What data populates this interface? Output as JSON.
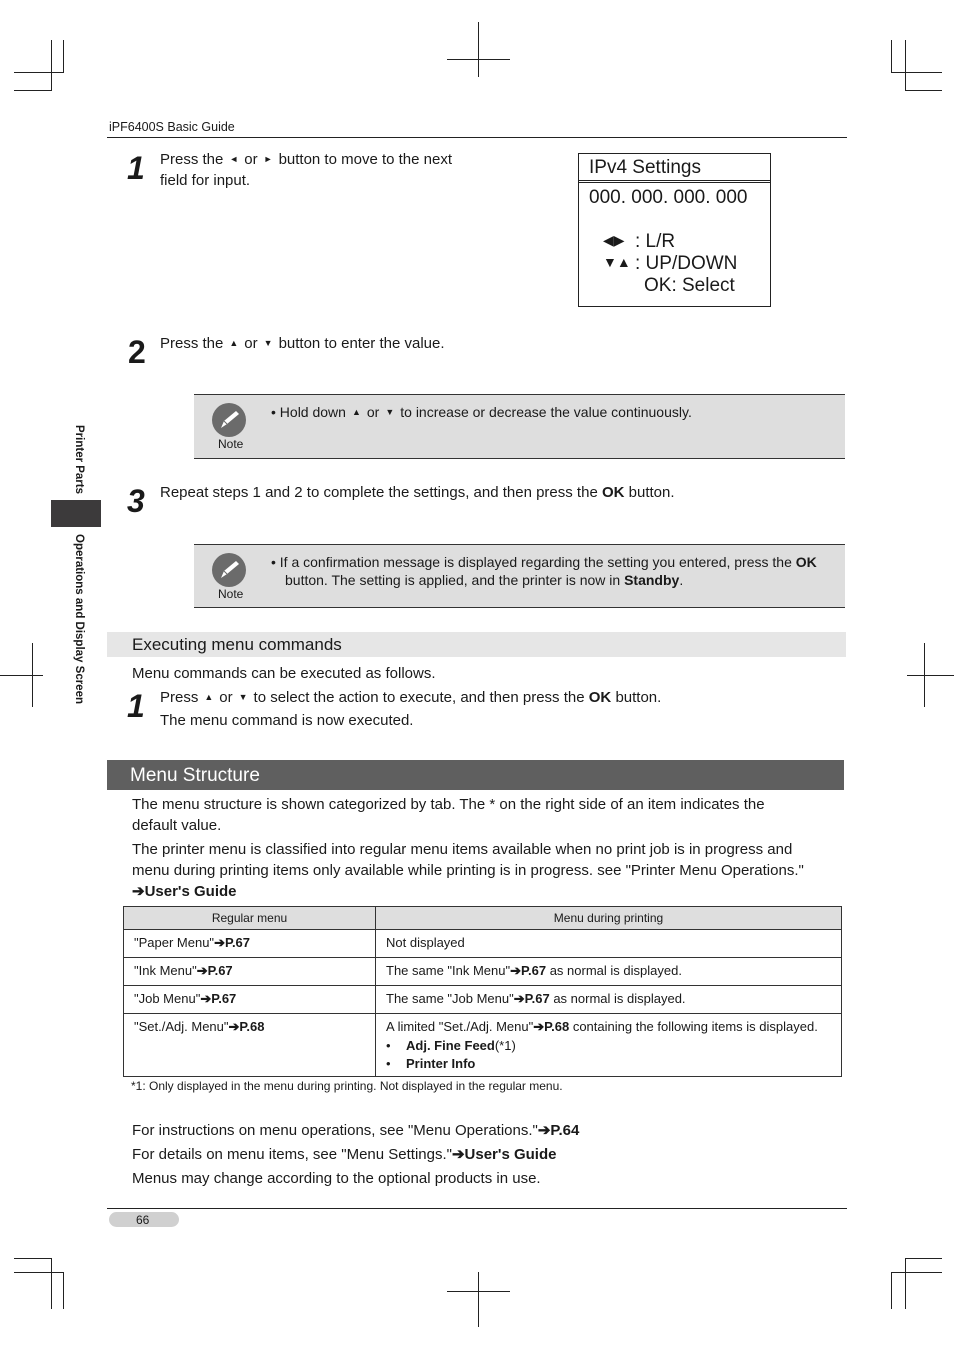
{
  "header": {
    "doc_title": "iPF6400S Basic Guide"
  },
  "sidebar": {
    "section_top": "Printer Parts",
    "section_bottom": "Operations and Display Screen"
  },
  "steps_a": [
    {
      "num": "1",
      "text_pre": "Press the",
      "sym1": "◄",
      "or": "or",
      "sym2": "►",
      "text_post": "button to move to the next",
      "line2": "field for input."
    },
    {
      "num": "2",
      "text_pre": "Press the",
      "sym1": "▲",
      "or": "or",
      "sym2": "▼",
      "text_post": "button to enter the value."
    },
    {
      "num": "3",
      "text_pre": "Repeat steps 1 and 2 to complete the settings, and then press the",
      "bold": "OK",
      "text_post": "button."
    }
  ],
  "lcd": {
    "title": "IPv4 Settings",
    "value": "000. 000. 000. 000",
    "lr_symbol": "◀▶",
    "lr_label": ": L/R",
    "ud_symbol": "▼▲",
    "ud_label": ": UP/DOWN",
    "ok_label": "OK: Select"
  },
  "notes": [
    {
      "label": "Note",
      "pre": "•  Hold down",
      "sym1": "▲",
      "or": "or",
      "sym2": "▼",
      "post": "to increase or decrease the value continuously."
    },
    {
      "label": "Note",
      "l1_pre": "•  If a confirmation message is displayed regarding the setting you entered, press the",
      "l1_bold": "OK",
      "l2_pre": "button. The setting is applied, and the printer is now in",
      "l2_bold": "Standby",
      "l2_post": "."
    }
  ],
  "executing": {
    "heading": "Executing menu commands",
    "intro": "Menu commands can be executed as follows.",
    "step": {
      "num": "1",
      "pre": "Press",
      "sym1": "▲",
      "or": "or",
      "sym2": "▼",
      "mid": "to select the action to execute, and then press the",
      "bold": "OK",
      "post": "button.",
      "line2": "The menu command is now executed."
    }
  },
  "menu_structure": {
    "heading": "Menu Structure",
    "p1": "The menu structure is shown categorized by tab. The * on the right side of an item indicates the",
    "p1b": "default value.",
    "p2": "The printer menu is classified into regular menu items available when no print job is in progress and",
    "p2b": "menu during printing items only available while printing is in progress. see \"Printer Menu Operations.\"",
    "p2_link": "➔User's Guide",
    "table": {
      "headers": [
        "Regular menu",
        "Menu during printing"
      ],
      "rows": [
        {
          "regular": "\"Paper Menu\"",
          "regular_ref": "➔P.67",
          "printing_pre": "Not displayed",
          "printing_ref": "",
          "printing_post": ""
        },
        {
          "regular": "\"Ink Menu\"",
          "regular_ref": "➔P.67",
          "printing_pre": "The same \"Ink Menu\"",
          "printing_ref": "➔P.67",
          "printing_post": " as normal is displayed."
        },
        {
          "regular": "\"Job Menu\"",
          "regular_ref": "➔P.67",
          "printing_pre": "The same \"Job Menu\"",
          "printing_ref": "➔P.67",
          "printing_post": " as normal is displayed."
        },
        {
          "regular": "\"Set./Adj. Menu\"",
          "regular_ref": "➔P.68",
          "printing_pre": "A limited \"Set./Adj. Menu\"",
          "printing_ref": "➔P.68",
          "printing_post": " containing the following items is displayed.",
          "sub_items": [
            {
              "bold": "Adj. Fine Feed",
              "suffix": "(*1)"
            },
            {
              "bold": "Printer Info",
              "suffix": ""
            }
          ]
        }
      ],
      "bullet": "•",
      "footnote": "*1:  Only displayed in the menu during printing. Not displayed in the regular menu."
    },
    "refs": [
      {
        "text": "For instructions on menu operations, see \"Menu Operations.\"",
        "link": "➔P.64"
      },
      {
        "text": "For details on menu items, see \"Menu Settings.\"",
        "link": "➔User's Guide"
      },
      {
        "text": "Menus may change according to the optional products in use.",
        "link": ""
      }
    ]
  },
  "footer": {
    "page_number": "66"
  }
}
